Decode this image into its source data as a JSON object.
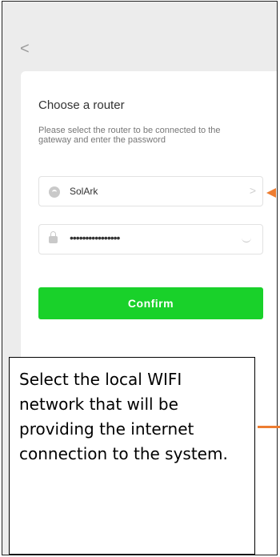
{
  "header": {
    "back_glyph": "<"
  },
  "card": {
    "title": "Choose a router",
    "description": "Please select the router to be connected to the gateway and enter the password",
    "ssid_field": {
      "value": "SolArk",
      "chevron": ">"
    },
    "password_field": {
      "value": "••••••••••••••••"
    },
    "confirm_label": "Confirm"
  },
  "callout": {
    "text": "Select the local WIFI network that will be providing the internet connection to the system."
  },
  "colors": {
    "accent_green": "#19d12a",
    "arrow_orange": "#ed7d31"
  },
  "icons": [
    "back-chevron-icon",
    "wifi-icon",
    "chevron-right-icon",
    "lock-icon",
    "eye-closed-icon"
  ]
}
